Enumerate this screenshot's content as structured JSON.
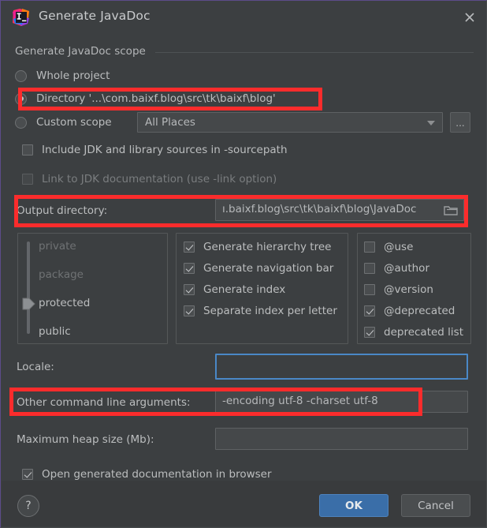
{
  "window": {
    "title": "Generate JavaDoc",
    "app_icon": "intellij-idea-icon",
    "close_icon": "close-icon"
  },
  "scope_group": {
    "label": "Generate JavaDoc scope",
    "options": [
      {
        "label": "Whole project",
        "selected": false
      },
      {
        "label": "Directory '...\\com.baixf.blog\\src\\tk\\baixf\\blog'",
        "selected": true
      },
      {
        "label": "Custom scope",
        "selected": false
      }
    ],
    "custom_scope_value": "All Places",
    "browse_button_label": "..."
  },
  "options": {
    "include_jdk": {
      "label": "Include JDK and library sources in -sourcepath",
      "checked": false,
      "disabled": false
    },
    "link_jdk": {
      "label": "Link to JDK documentation (use -link option)",
      "checked": false,
      "disabled": true
    }
  },
  "output": {
    "label": "Output directory:",
    "value": "ı.baixf.blog\\src\\tk\\baixf\\blog\\JavaDoc",
    "browse_icon": "folder-icon"
  },
  "visibility": {
    "items": [
      {
        "label": "private",
        "active": false
      },
      {
        "label": "package",
        "active": false
      },
      {
        "label": "protected",
        "active": true
      },
      {
        "label": "public",
        "active": false
      }
    ],
    "selected": "protected"
  },
  "generate_panel": {
    "items": [
      {
        "label": "Generate hierarchy tree",
        "checked": true
      },
      {
        "label": "Generate navigation bar",
        "checked": true
      },
      {
        "label": "Generate index",
        "checked": true
      },
      {
        "label": "Separate index per letter",
        "checked": true
      }
    ]
  },
  "tags_panel": {
    "items": [
      {
        "label": "@use",
        "checked": false
      },
      {
        "label": "@author",
        "checked": false
      },
      {
        "label": "@version",
        "checked": false
      },
      {
        "label": "@deprecated",
        "checked": true
      },
      {
        "label": "deprecated list",
        "checked": true
      }
    ]
  },
  "locale": {
    "label": "Locale:",
    "value": "",
    "placeholder": ""
  },
  "args": {
    "label": "Other command line arguments:",
    "value": "-encoding utf-8 -charset utf-8",
    "placeholder": ""
  },
  "heap": {
    "label": "Maximum heap size (Mb):",
    "value": "",
    "placeholder": ""
  },
  "open_browser": {
    "label": "Open generated documentation in browser",
    "checked": true
  },
  "footer": {
    "help_label": "?",
    "ok_label": "OK",
    "cancel_label": "Cancel"
  },
  "colors": {
    "dialog_bg": "#3c3f41",
    "footer_bg": "#393b3d",
    "field_bg": "#45484a",
    "border": "#5e6163",
    "text": "#bcbebf",
    "disabled_text": "#7a7d7f",
    "accent_button": "#3a6ea8",
    "focus_border": "#4a88c7",
    "annotation_red": "#fb2c2c",
    "window_border": "#5c4b8a"
  }
}
